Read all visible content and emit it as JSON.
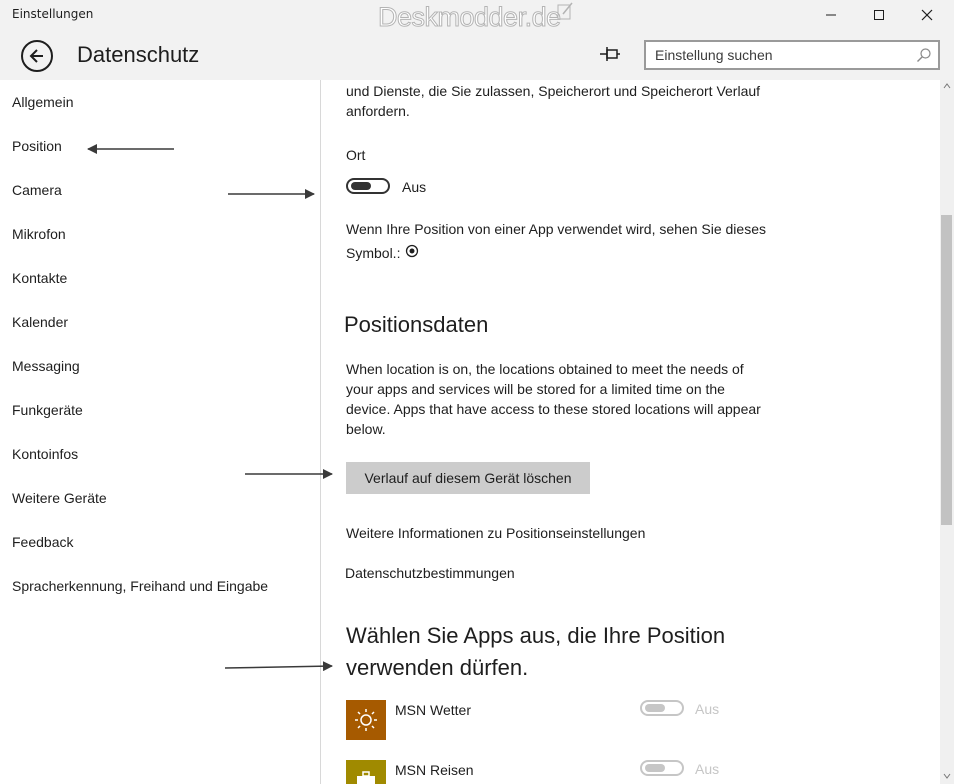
{
  "window": {
    "title": "Einstellungen",
    "watermark": "Deskmodder.de"
  },
  "header": {
    "page_title": "Datenschutz",
    "search_placeholder": "Einstellung suchen"
  },
  "sidebar": {
    "items": [
      {
        "label": "Allgemein"
      },
      {
        "label": "Position"
      },
      {
        "label": "Camera"
      },
      {
        "label": "Mikrofon"
      },
      {
        "label": "Kontakte"
      },
      {
        "label": "Kalender"
      },
      {
        "label": "Messaging"
      },
      {
        "label": "Funkgeräte"
      },
      {
        "label": "Kontoinfos"
      },
      {
        "label": "Weitere Geräte"
      },
      {
        "label": "Feedback"
      },
      {
        "label": "Spracherkennung, Freihand und Eingabe"
      }
    ]
  },
  "content": {
    "intro_line1": "und Dienste, die Sie zulassen, Speicherort und Speicherort Verlauf",
    "intro_line2": "anfordern.",
    "ort_label": "Ort",
    "ort_toggle_state": "Aus",
    "symbol_line1": "Wenn Ihre Position von einer App verwendet wird, sehen Sie dieses",
    "symbol_line2": "Symbol.:",
    "positionsdaten_heading": "Positionsdaten",
    "positionsdaten_desc1": "When location is on, the locations obtained to meet the needs of",
    "positionsdaten_desc2": "your apps and services will be stored for a limited time on the",
    "positionsdaten_desc3": "device. Apps that have access to these stored locations will appear",
    "positionsdaten_desc4": "below.",
    "clear_button": "Verlauf auf diesem Gerät löschen",
    "more_info_link": "Weitere Informationen zu Positionseinstellungen",
    "privacy_link": "Datenschutzbestimmungen",
    "apps_heading_line1": "Wählen Sie Apps aus, die Ihre Position",
    "apps_heading_line2": "verwenden dürfen.",
    "apps": [
      {
        "name": "MSN Wetter",
        "state": "Aus",
        "tile_color": "#a65a00"
      },
      {
        "name": "MSN Reisen",
        "state": "Aus",
        "tile_color": "#a08a00"
      }
    ]
  },
  "colors": {
    "header_bg": "#f2f2f2",
    "button_bg": "#cccccc",
    "toggle_dark": "#333333",
    "toggle_disabled": "#c6c6c6"
  }
}
